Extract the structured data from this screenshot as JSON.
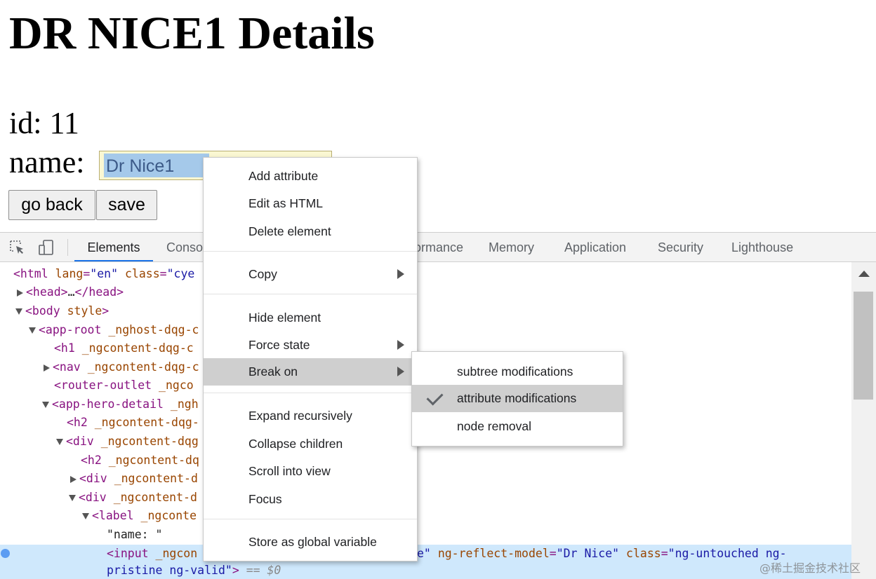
{
  "page": {
    "title": "DR NICE1 Details",
    "id_line": "id: 11",
    "name_label": "name:",
    "name_value": "Dr Nice1",
    "go_back_label": "go back",
    "save_label": "save"
  },
  "devtools": {
    "tabs": [
      {
        "label": "Elements",
        "active": true
      },
      {
        "label": "Conso"
      },
      {
        "label": "rformance"
      },
      {
        "label": "Memory"
      },
      {
        "label": "Application"
      },
      {
        "label": "Security"
      },
      {
        "label": "Lighthouse"
      }
    ],
    "tree": {
      "r0": {
        "tag": "<html",
        "a1": "lang",
        "v1": "\"en\"",
        "a2": "class",
        "v2": "\"cye"
      },
      "r1": {
        "tag": "<head>",
        "ell": "…",
        "close": "</head>"
      },
      "r2": {
        "tag": "<body",
        "a1": "style",
        "close": ">"
      },
      "r3": {
        "tag": "<app-root",
        "a1": "_nghost-dqg-c"
      },
      "r4": {
        "tag": "<h1",
        "a1": "_ngcontent-dqg-c"
      },
      "r5": {
        "tag": "<nav",
        "a1": "_ngcontent-dqg-c"
      },
      "r6": {
        "tag": "<router-outlet",
        "a1": "_ngco"
      },
      "r7": {
        "tag": "<app-hero-detail",
        "a1": "_ngh"
      },
      "r8": {
        "tag": "<h2",
        "a1": "_ngcontent-dqg-"
      },
      "r9": {
        "tag": "<div",
        "a1": "_ngcontent-dqg"
      },
      "r10": {
        "tag": "<h2",
        "a1": "_ngcontent-dq"
      },
      "r11": {
        "tag": "<div",
        "a1": "_ngcontent-d"
      },
      "r12": {
        "tag": "<div",
        "a1": "_ngcontent-d"
      },
      "r13": {
        "tag": "<label",
        "a1": "_ngconte"
      },
      "r14": {
        "text": "\"name: \""
      },
      "r15": {
        "tag": "<input",
        "a1": "_ngcon",
        "v0": "e\"",
        "a2": "ng-reflect-model",
        "v2": "\"Dr Nice\"",
        "a3": "class",
        "v3": "\"ng-untouched ng-"
      },
      "r16": {
        "v": "pristine ng-valid\"",
        "close": ">",
        "eq": "== $0"
      }
    }
  },
  "context_menu": {
    "items": {
      "add_attribute": "Add attribute",
      "edit_as_html": "Edit as HTML",
      "delete_element": "Delete element",
      "copy": "Copy",
      "hide_element": "Hide element",
      "force_state": "Force state",
      "break_on": "Break on",
      "expand_recursively": "Expand recursively",
      "collapse_children": "Collapse children",
      "scroll_into_view": "Scroll into view",
      "focus": "Focus",
      "store_as_global_variable": "Store as global variable"
    },
    "break_on_submenu": {
      "subtree_modifications": "subtree modifications",
      "attribute_modifications": "attribute modifications",
      "attribute_modifications_checked": true,
      "node_removal": "node removal"
    }
  },
  "watermark": "@稀土掘金技术社区",
  "colors": {
    "devtools_accent": "#1a73e8",
    "selected_row": "#cfe8fc",
    "menu_highlight": "#cfcfcf",
    "tag_color": "#881280",
    "attr_color": "#994500",
    "value_color": "#1a1aa6"
  }
}
